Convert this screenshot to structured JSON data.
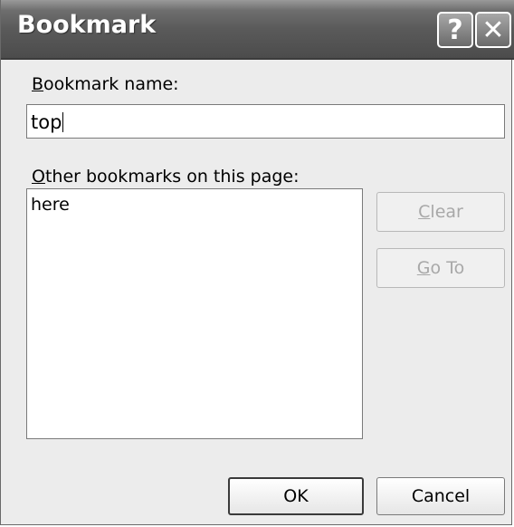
{
  "window": {
    "title": "Bookmark",
    "help_glyph": "?",
    "close_glyph": "✕"
  },
  "name_field": {
    "label_mnemonic": "B",
    "label_rest": "ookmark name:",
    "value": "top"
  },
  "other_bookmarks": {
    "label_mnemonic": "O",
    "label_rest": "ther bookmarks on this page:",
    "items": [
      "here"
    ]
  },
  "buttons": {
    "clear_mnemonic": "C",
    "clear_rest": "lear",
    "goto_mnemonic": "G",
    "goto_rest": "o To",
    "ok": "OK",
    "cancel": "Cancel"
  }
}
